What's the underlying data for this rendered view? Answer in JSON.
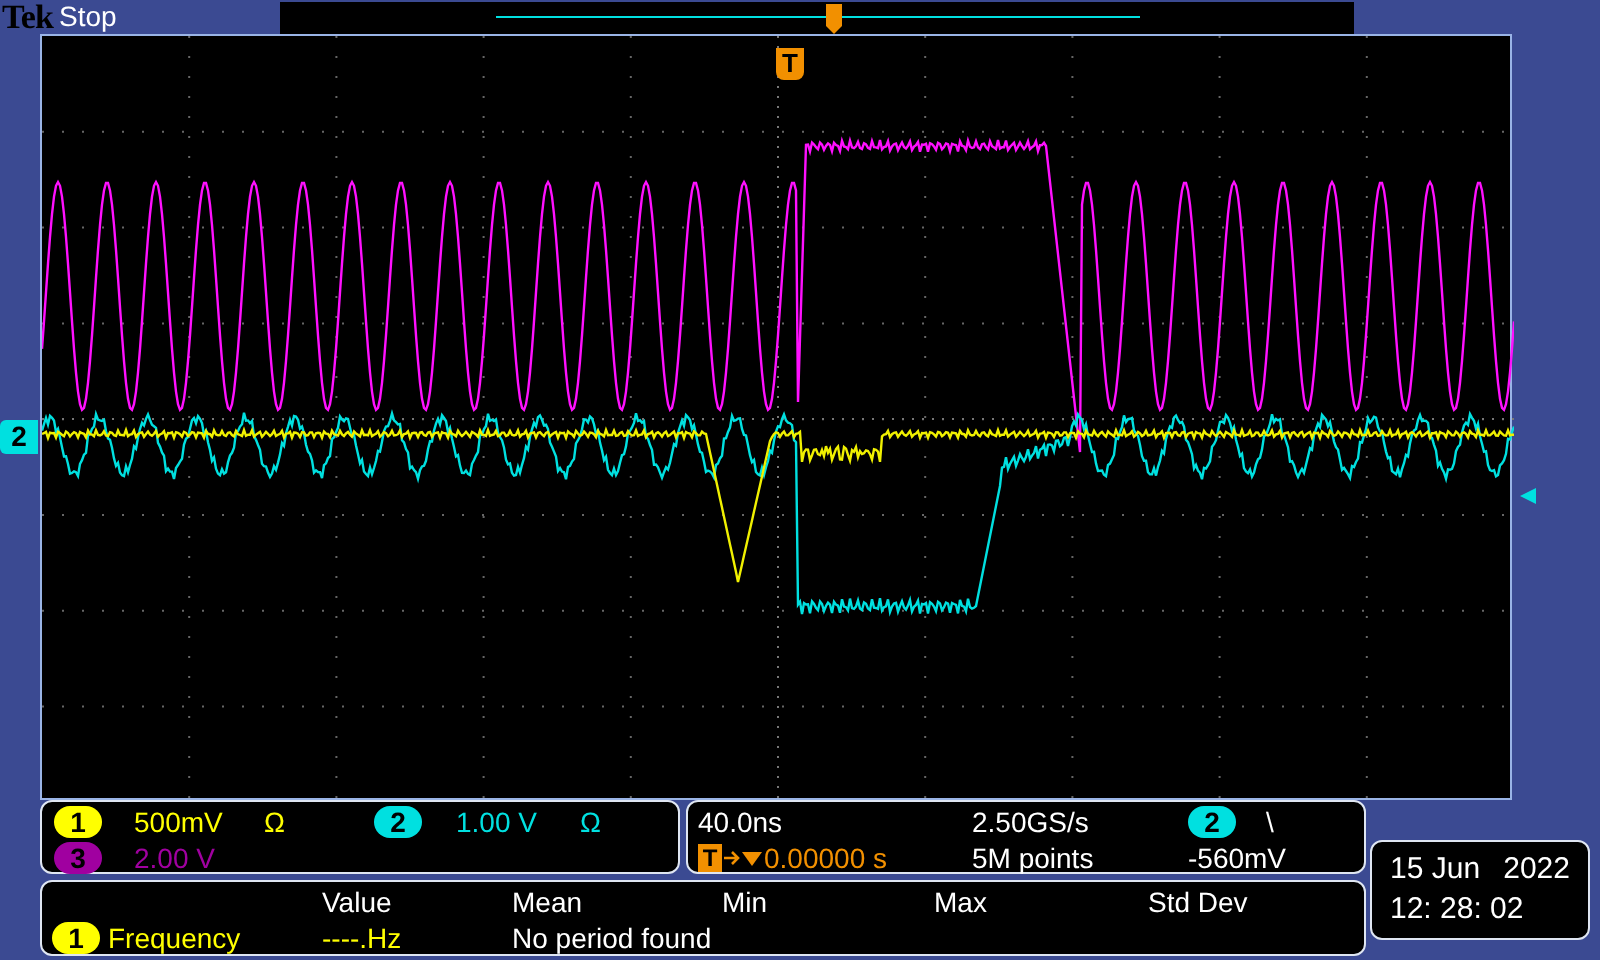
{
  "header": {
    "brand": "Tek",
    "status": "Stop"
  },
  "graticule": {
    "trigger_marker": "T",
    "channel_marker": "2"
  },
  "channels": [
    {
      "number": "1",
      "scale": "500mV",
      "coupling": "Ω",
      "color": "#ffff00"
    },
    {
      "number": "2",
      "scale": "1.00 V",
      "coupling": "Ω",
      "color": "#00e0e0"
    },
    {
      "number": "3",
      "scale": "2.00 V",
      "color": "#a000a0"
    }
  ],
  "timebase": {
    "scale": "40.0ns",
    "trigger_label": "T",
    "position": "0.00000 s",
    "sample_rate": "2.50GS/s",
    "record_length": "5M points",
    "trigger_source": "2",
    "slope": "\\",
    "level": "-560mV"
  },
  "date": {
    "day": "15 Jun",
    "year": "2022",
    "time": "12: 28: 02"
  },
  "measurements": {
    "columns": [
      "Value",
      "Mean",
      "Min",
      "Max",
      "Std Dev"
    ],
    "rows": [
      {
        "source": "1",
        "color": "#ffff00",
        "name": "Frequency",
        "value": "----.Hz",
        "mean": "No period found"
      }
    ]
  }
}
